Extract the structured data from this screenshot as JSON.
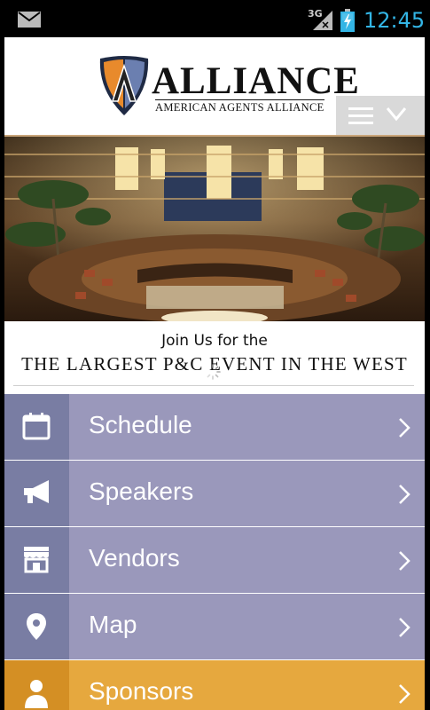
{
  "status_bar": {
    "network": "3G",
    "time": "12:45",
    "icons": [
      "mail-icon",
      "signal-icon",
      "battery-charging-icon"
    ]
  },
  "header": {
    "logo_title": "ALLIANCE",
    "logo_subtitle": "AMERICAN AGENTS ALLIANCE",
    "menu_icon": "hamburger-chevron-icon"
  },
  "promo": {
    "line1": "Join Us for the",
    "line2": "THE LARGEST P&C EVENT IN THE WEST"
  },
  "nav": {
    "items": [
      {
        "label": "Schedule",
        "icon": "calendar-icon"
      },
      {
        "label": "Speakers",
        "icon": "megaphone-icon"
      },
      {
        "label": "Vendors",
        "icon": "storefront-icon"
      },
      {
        "label": "Map",
        "icon": "map-pin-icon"
      },
      {
        "label": "Sponsors",
        "icon": "person-icon"
      }
    ]
  },
  "colors": {
    "status_accent": "#33b5e5",
    "nav_bg": "#9a98bb",
    "nav_icon_bg": "#797da3",
    "sponsors_bg": "#e6a83e",
    "sponsors_icon_bg": "#d48f24"
  }
}
